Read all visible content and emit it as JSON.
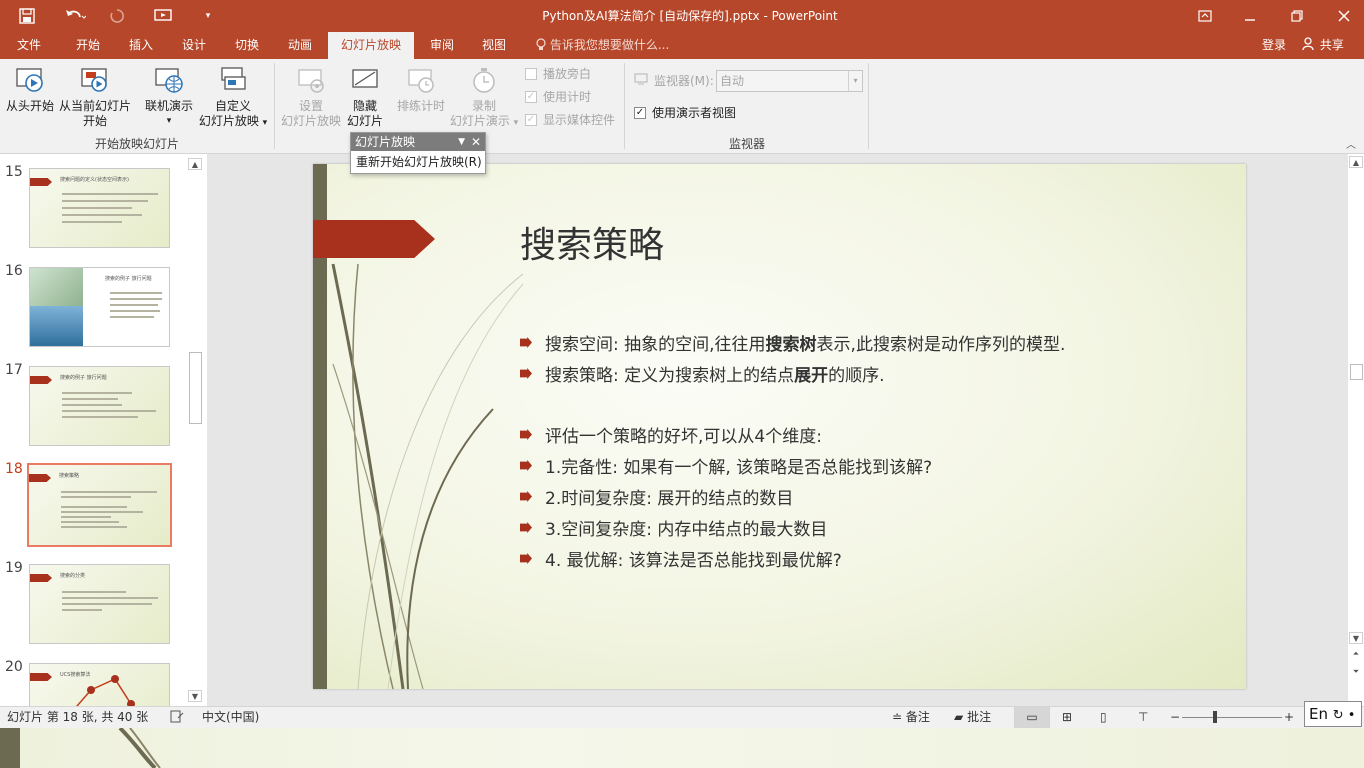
{
  "titlebar": {
    "title": "Python及AI算法简介 [自动保存的].pptx - PowerPoint",
    "login": "登录",
    "share": "共享"
  },
  "tabs": [
    "文件",
    "开始",
    "插入",
    "设计",
    "切换",
    "动画",
    "幻灯片放映",
    "审阅",
    "视图"
  ],
  "active_tab": "幻灯片放映",
  "tell_me": "告诉我您想要做什么...",
  "ribbon": {
    "from_beginning": "从头开始",
    "from_current_1": "从当前幻灯片",
    "from_current_2": "开始",
    "online_present": "联机演示",
    "custom_1": "自定义",
    "custom_2": "幻灯片放映",
    "group1_label": "开始放映幻灯片",
    "setup_1": "设置",
    "setup_2": "幻灯片放映",
    "hide_1": "隐藏",
    "hide_2": "幻灯片",
    "rehearse": "排练计时",
    "record_1": "录制",
    "record_2": "幻灯片演示",
    "chk_narration": "播放旁白",
    "chk_timings": "使用计时",
    "chk_media": "显示媒体控件",
    "monitor_label": "监视器(M):",
    "monitor_value": "自动",
    "presenter_view": "使用演示者视图",
    "group3_label": "监视器"
  },
  "popup": {
    "title": "幻灯片放映",
    "item": "重新开始幻灯片放映(R)"
  },
  "thumbnails": [
    {
      "num": "15",
      "title": "搜索问题的定义(状态空间表示)"
    },
    {
      "num": "16",
      "title": "搜索的例子 旅行问题"
    },
    {
      "num": "17",
      "title": "搜索的例子 旅行问题"
    },
    {
      "num": "18",
      "title": "搜索策略"
    },
    {
      "num": "19",
      "title": "搜索的分类"
    },
    {
      "num": "20",
      "title": "UCS搜索算法"
    }
  ],
  "slide": {
    "title": "搜索策略",
    "b1_pre": "搜索空间: 抽象的空间,往往用",
    "b1_bold": "搜索树",
    "b1_post": "表示,此搜索树是动作序列的模型.",
    "b2_pre": "搜索策略: 定义为搜索树上的结点",
    "b2_bold": "展开",
    "b2_post": "的顺序.",
    "b3": "评估一个策略的好坏,可以从4个维度:",
    "b4": "1.完备性: 如果有一个解, 该策略是否总能找到该解?",
    "b5": "2.时间复杂度: 展开的结点的数目",
    "b6": "3.空间复杂度: 内存中结点的最大数目",
    "b7": "4. 最优解: 该算法是否总能找到最优解?"
  },
  "status": {
    "slide_info": "幻灯片 第 18 张, 共 40 张",
    "language": "中文(中国)",
    "notes": "备注",
    "comments": "批注"
  },
  "ime": "En"
}
